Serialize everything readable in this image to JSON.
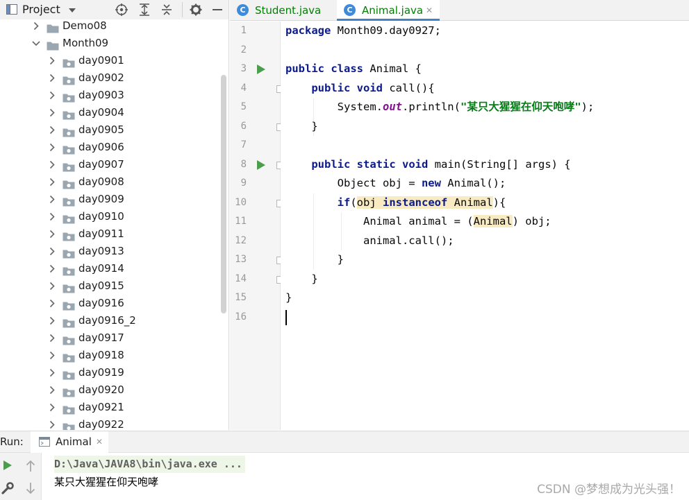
{
  "project_panel": {
    "title": "Project",
    "tree": [
      {
        "label": "Demo08",
        "expanded": false,
        "level": 0
      },
      {
        "label": "Month09",
        "expanded": true,
        "level": 0
      },
      {
        "label": "day0901",
        "expanded": false,
        "level": 1
      },
      {
        "label": "day0902",
        "expanded": false,
        "level": 1
      },
      {
        "label": "day0903",
        "expanded": false,
        "level": 1
      },
      {
        "label": "day0904",
        "expanded": false,
        "level": 1
      },
      {
        "label": "day0905",
        "expanded": false,
        "level": 1
      },
      {
        "label": "day0906",
        "expanded": false,
        "level": 1
      },
      {
        "label": "day0907",
        "expanded": false,
        "level": 1
      },
      {
        "label": "day0908",
        "expanded": false,
        "level": 1
      },
      {
        "label": "day0909",
        "expanded": false,
        "level": 1
      },
      {
        "label": "day0910",
        "expanded": false,
        "level": 1
      },
      {
        "label": "day0911",
        "expanded": false,
        "level": 1
      },
      {
        "label": "day0913",
        "expanded": false,
        "level": 1
      },
      {
        "label": "day0914",
        "expanded": false,
        "level": 1
      },
      {
        "label": "day0915",
        "expanded": false,
        "level": 1
      },
      {
        "label": "day0916",
        "expanded": false,
        "level": 1
      },
      {
        "label": "day0916_2",
        "expanded": false,
        "level": 1
      },
      {
        "label": "day0917",
        "expanded": false,
        "level": 1
      },
      {
        "label": "day0918",
        "expanded": false,
        "level": 1
      },
      {
        "label": "day0919",
        "expanded": false,
        "level": 1
      },
      {
        "label": "day0920",
        "expanded": false,
        "level": 1
      },
      {
        "label": "day0921",
        "expanded": false,
        "level": 1
      },
      {
        "label": "day0922",
        "expanded": false,
        "level": 1
      }
    ]
  },
  "editor": {
    "tabs": [
      {
        "label": "Student.java",
        "active": false
      },
      {
        "label": "Animal.java",
        "active": true
      }
    ],
    "lines": [
      {
        "no": "1",
        "tokens": [
          {
            "t": "package",
            "c": "kw"
          },
          {
            "t": " Month09.day0927;"
          }
        ]
      },
      {
        "no": "2",
        "tokens": []
      },
      {
        "no": "3",
        "run": true,
        "tokens": [
          {
            "t": "public",
            "c": "kw"
          },
          {
            "t": " "
          },
          {
            "t": "class",
            "c": "kw"
          },
          {
            "t": " Animal {"
          }
        ]
      },
      {
        "no": "4",
        "fold": true,
        "tokens": [
          {
            "t": "    "
          },
          {
            "t": "public",
            "c": "kw"
          },
          {
            "t": " "
          },
          {
            "t": "void",
            "c": "kw"
          },
          {
            "t": " call(){"
          }
        ]
      },
      {
        "no": "5",
        "tokens": [
          {
            "t": "        System."
          },
          {
            "t": "out",
            "c": "fld"
          },
          {
            "t": ".println("
          },
          {
            "t": "\"某只大猩猩在仰天咆哮\"",
            "c": "str"
          },
          {
            "t": ");"
          }
        ]
      },
      {
        "no": "6",
        "fold": true,
        "tokens": [
          {
            "t": "    }"
          }
        ]
      },
      {
        "no": "7",
        "tokens": []
      },
      {
        "no": "8",
        "run": true,
        "fold": true,
        "tokens": [
          {
            "t": "    "
          },
          {
            "t": "public",
            "c": "kw"
          },
          {
            "t": " "
          },
          {
            "t": "static",
            "c": "kw"
          },
          {
            "t": " "
          },
          {
            "t": "void",
            "c": "kw"
          },
          {
            "t": " main(String[] args) {"
          }
        ]
      },
      {
        "no": "9",
        "tokens": [
          {
            "t": "        Object obj = "
          },
          {
            "t": "new",
            "c": "kw"
          },
          {
            "t": " Animal();"
          }
        ]
      },
      {
        "no": "10",
        "fold": true,
        "tokens": [
          {
            "t": "        "
          },
          {
            "t": "if",
            "c": "kw"
          },
          {
            "t": "("
          },
          {
            "t": "obj ",
            "c": "hl"
          },
          {
            "t": "instanceof",
            "c": "kw hl"
          },
          {
            "t": " Animal",
            "c": "hl"
          },
          {
            "t": "){"
          }
        ]
      },
      {
        "no": "11",
        "tokens": [
          {
            "t": "            Animal animal = ("
          },
          {
            "t": "Animal",
            "c": "hl"
          },
          {
            "t": ") obj;"
          }
        ]
      },
      {
        "no": "12",
        "tokens": [
          {
            "t": "            animal.call();"
          }
        ]
      },
      {
        "no": "13",
        "fold": true,
        "tokens": [
          {
            "t": "        }"
          }
        ]
      },
      {
        "no": "14",
        "fold": true,
        "tokens": [
          {
            "t": "    }"
          }
        ]
      },
      {
        "no": "15",
        "tokens": [
          {
            "t": "}"
          }
        ]
      },
      {
        "no": "16",
        "tokens": []
      }
    ]
  },
  "run_panel": {
    "label": "Run:",
    "tab_label": "Animal",
    "command": "D:\\Java\\JAVA8\\bin\\java.exe ...",
    "output": "某只大猩猩在仰天咆哮"
  },
  "watermark": "CSDN @梦想成为光头强！",
  "colors": {
    "keyword": "#0c1a8a",
    "string": "#067d17",
    "field": "#871094",
    "highlight": "#f8ebc2",
    "run_green": "#4b9e4b",
    "tab_text": "#008000"
  }
}
